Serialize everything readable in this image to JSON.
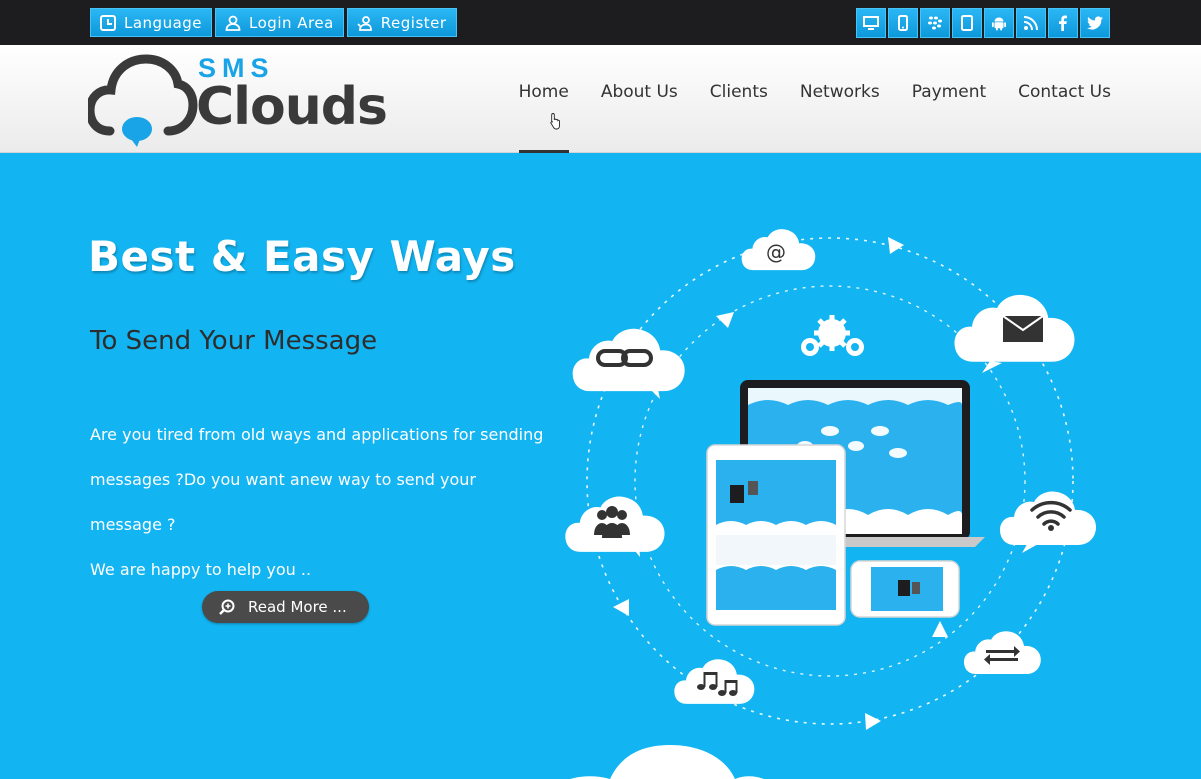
{
  "topbar": {
    "left_buttons": [
      {
        "label": "Language",
        "icon": "clock-icon"
      },
      {
        "label": "Login Area",
        "icon": "user-icon"
      },
      {
        "label": "Register",
        "icon": "register-icon"
      }
    ],
    "social_icons": [
      "desktop-icon",
      "mobile-icon",
      "blackberry-icon",
      "tablet-icon",
      "android-icon",
      "rss-icon",
      "facebook-icon",
      "twitter-icon"
    ]
  },
  "logo": {
    "top": "SMS",
    "bottom": "Clouds"
  },
  "nav": {
    "items": [
      "Home",
      "About Us",
      "Clients",
      "Networks",
      "Payment",
      "Contact Us"
    ],
    "active": "Home"
  },
  "hero": {
    "title": "Best & Easy Ways",
    "subtitle": "To Send Your Message",
    "desc_line1": "Are you tired from old ways and applications for sending",
    "desc_line2": "messages ?Do you want anew way to send your message ?",
    "desc_line3": "We are happy to help you ..",
    "read_more": "Read More ..."
  },
  "illustration": {
    "at_symbol": "@"
  },
  "colors": {
    "hero_bg": "#12b4f1",
    "accent": "#1aa4e8",
    "dark": "#333333"
  }
}
